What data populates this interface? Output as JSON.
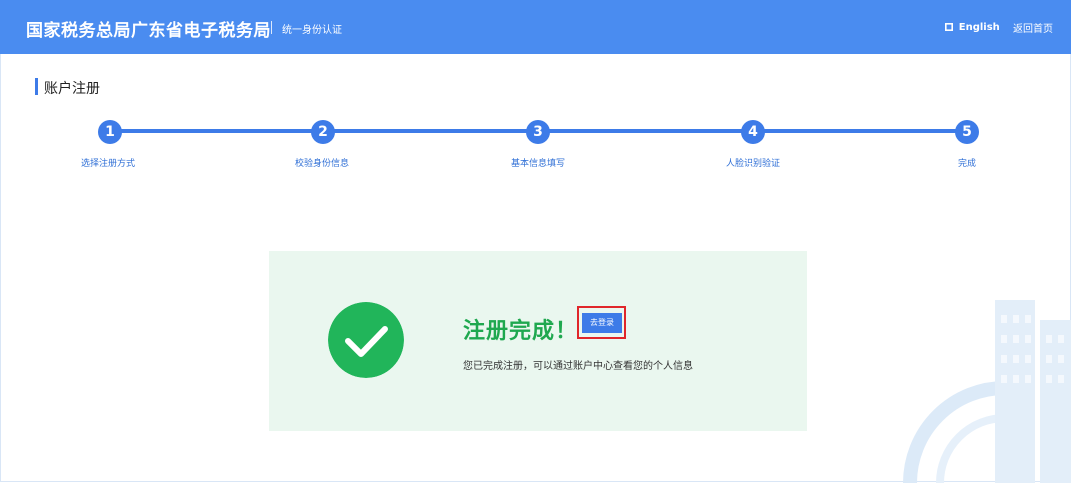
{
  "header": {
    "brand": "国家税务总局广东省电子税务局",
    "subtitle": "统一身份认证",
    "english_link": "English",
    "home_link": "返回首页"
  },
  "page": {
    "title": "账户注册"
  },
  "steps": [
    {
      "number": "1",
      "label": "选择注册方式"
    },
    {
      "number": "2",
      "label": "校验身份信息"
    },
    {
      "number": "3",
      "label": "基本信息填写"
    },
    {
      "number": "4",
      "label": "人脸识别验证"
    },
    {
      "number": "5",
      "label": "完成"
    }
  ],
  "result": {
    "title": "注册完成！",
    "login_button": "去登录",
    "description": "您已完成注册，可以通过账户中心查看您的个人信息"
  },
  "colors": {
    "header_bg": "#4a8cf0",
    "step_blue": "#3d7be8",
    "success_green": "#21b55a",
    "panel_bg": "#eaf7ef",
    "highlight_red": "#e0262a"
  },
  "icons": {
    "english": "globe-icon",
    "success": "check-circle-icon",
    "background": "building-watermark-icon"
  }
}
